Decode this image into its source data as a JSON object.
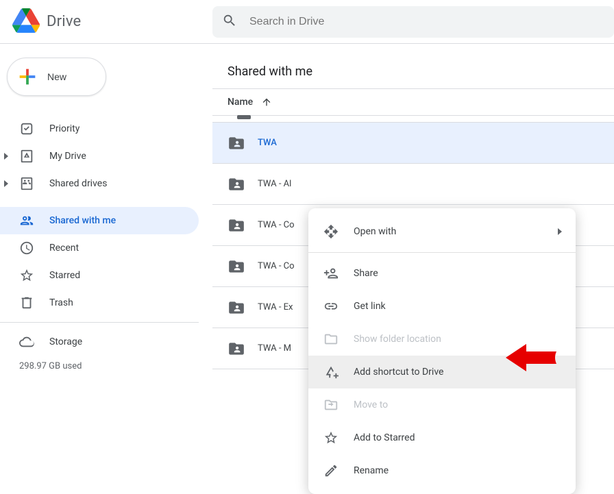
{
  "brand": {
    "name": "Drive"
  },
  "search": {
    "placeholder": "Search in Drive"
  },
  "new_button": {
    "label": "New"
  },
  "sidebar": {
    "items": [
      {
        "label": "Priority"
      },
      {
        "label": "My Drive"
      },
      {
        "label": "Shared drives"
      },
      {
        "label": "Shared with me"
      },
      {
        "label": "Recent"
      },
      {
        "label": "Starred"
      },
      {
        "label": "Trash"
      },
      {
        "label": "Storage"
      }
    ],
    "storage_used": "298.97 GB used"
  },
  "main": {
    "title": "Shared with me",
    "column_name": "Name",
    "files": [
      {
        "name": "TWA"
      },
      {
        "name": "TWA - Al"
      },
      {
        "name": "TWA - Co"
      },
      {
        "name": "TWA - Co"
      },
      {
        "name": "TWA - Ex"
      },
      {
        "name": "TWA - M"
      }
    ]
  },
  "context_menu": {
    "open_with": "Open with",
    "share": "Share",
    "get_link": "Get link",
    "show_folder_location": "Show folder location",
    "add_shortcut": "Add shortcut to Drive",
    "move_to": "Move to",
    "add_to_starred": "Add to Starred",
    "rename": "Rename"
  }
}
